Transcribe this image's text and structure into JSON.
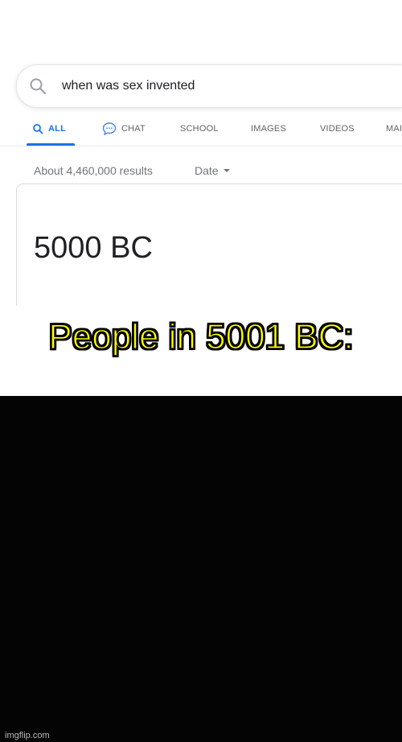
{
  "search": {
    "query": "when was sex invented"
  },
  "tabs": [
    {
      "label": "ALL",
      "icon": "search-icon",
      "active": true
    },
    {
      "label": "CHAT",
      "icon": "chat-icon",
      "active": false
    },
    {
      "label": "SCHOOL",
      "active": false
    },
    {
      "label": "IMAGES",
      "active": false
    },
    {
      "label": "VIDEOS",
      "active": false
    },
    {
      "label": "MAI",
      "active": false
    }
  ],
  "results": {
    "count_text": "About 4,460,000 results",
    "date_filter": "Date"
  },
  "answer": {
    "text": "5000 BC"
  },
  "caption": {
    "text": "People in 5001 BC:",
    "color": "#ffff00"
  },
  "watermark": "imgflip.com",
  "colors": {
    "accent": "#1a73e8",
    "panel_dark": "#050405"
  }
}
